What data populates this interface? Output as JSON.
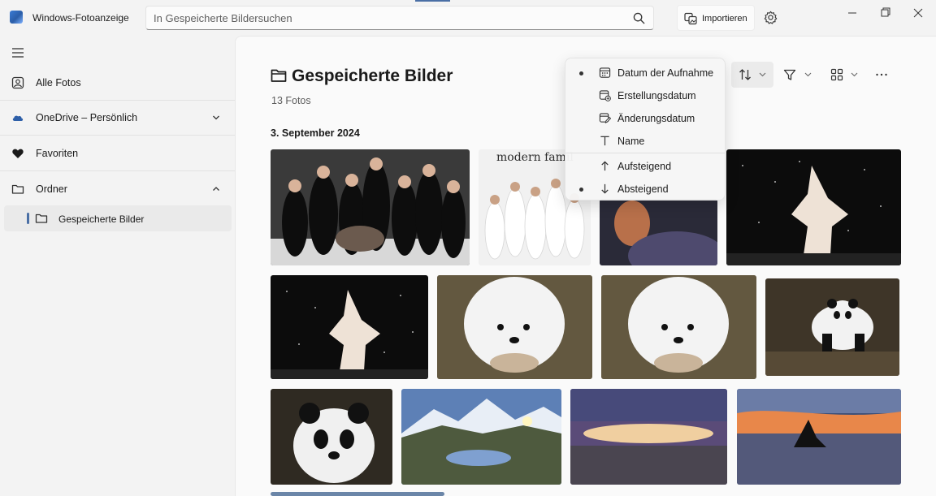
{
  "titlebar": {
    "app_title": "Windows-Fotoanzeige",
    "search_placeholder": "In Gespeicherte Bildersuchen",
    "import_label": "Importieren"
  },
  "sidebar": {
    "items": [
      {
        "label": "Alle Fotos",
        "icon": "photos-icon"
      },
      {
        "label": "OneDrive – Persönlich",
        "icon": "cloud-icon",
        "expandable": true,
        "expanded": false
      },
      {
        "label": "Favoriten",
        "icon": "heart-icon"
      },
      {
        "label": "Ordner",
        "icon": "folder-icon",
        "expandable": true,
        "expanded": true
      }
    ],
    "subitem": {
      "label": "Gespeicherte Bilder",
      "icon": "folder-icon",
      "selected": true
    }
  },
  "main": {
    "title": "Gespeicherte Bilder",
    "count": "13 Fotos",
    "date_heading": "3. September 2024"
  },
  "toolbar": {
    "sort_icon": "sort-icon",
    "filter_icon": "filter-icon",
    "view_icon": "view-icon",
    "more_icon": "more-icon"
  },
  "sort_menu": {
    "items": [
      {
        "label": "Datum der Aufnahme",
        "icon": "calendar-icon",
        "selected": true
      },
      {
        "label": "Erstellungsdatum",
        "icon": "calendar-add-icon",
        "selected": false
      },
      {
        "label": "Änderungsdatum",
        "icon": "calendar-edit-icon",
        "selected": false
      },
      {
        "label": "Name",
        "icon": "text-icon",
        "selected": false
      },
      {
        "label": "Aufsteigend",
        "icon": "arrow-up-icon",
        "selected": false
      },
      {
        "label": "Absteigend",
        "icon": "arrow-down-icon",
        "selected": true
      }
    ]
  },
  "photos": {
    "overlay_text": "modern famil"
  },
  "colors": {
    "accent": "#4a6fa5",
    "sidebar_bg": "#f3f3f3",
    "content_bg": "#fafafa"
  }
}
